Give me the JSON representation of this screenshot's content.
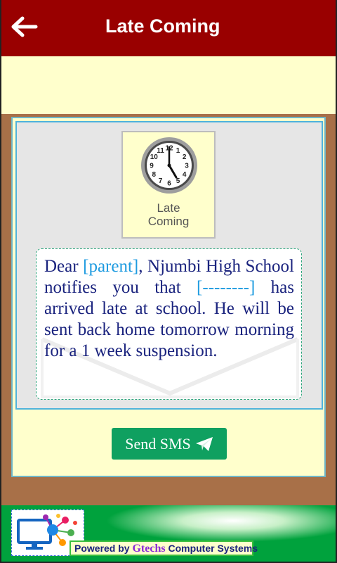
{
  "app_bar": {
    "title": "Late Coming",
    "color": "#990000"
  },
  "clock_tile": {
    "label_line1": "Late",
    "label_line2": "Coming",
    "clock_numbers": [
      "12",
      "1",
      "2",
      "3",
      "4",
      "5",
      "6",
      "7",
      "8",
      "9",
      "10",
      "11"
    ]
  },
  "message": {
    "part1": "Dear ",
    "placeholder1": "[parent]",
    "part2": ", Njumbi High School notifies you that ",
    "placeholder2": "[--------]",
    "part3": " has arrived late at school. He will be sent back home tomorrow morning for a 1 week suspension."
  },
  "send_button": {
    "label": "Send SMS",
    "icon": "paper-plane-icon",
    "color": "#0fa060"
  },
  "footer": {
    "powered_by": "Powered by ",
    "brand": "Gtechs",
    "word2": " Computer",
    "word3": " Systems"
  }
}
